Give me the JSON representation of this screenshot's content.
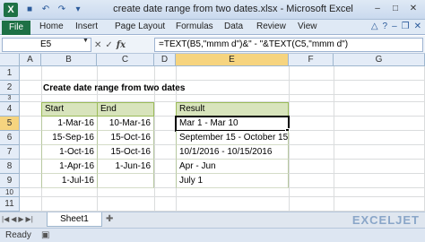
{
  "window": {
    "app_icon": "X",
    "title": "create date range from two dates.xlsx  -  Microsoft Excel",
    "controls": [
      "–",
      "□",
      "✕"
    ]
  },
  "ribbon": {
    "file": "File",
    "tabs": [
      "Home",
      "Insert",
      "Page Layout",
      "Formulas",
      "Data",
      "Review",
      "View"
    ]
  },
  "formula_bar": {
    "name_box": "E5",
    "fx": "fx",
    "formula": "=TEXT(B5,\"mmm d\")&\" - \"&TEXT(C5,\"mmm d\")"
  },
  "columns": [
    "A",
    "B",
    "C",
    "D",
    "E",
    "F",
    "G"
  ],
  "active_column": "E",
  "rows": [
    "1",
    "2",
    "3",
    "4",
    "5",
    "6",
    "7",
    "8",
    "9",
    "10",
    "11"
  ],
  "active_row": "5",
  "sheet": {
    "title": "Create date range from two dates",
    "start_header": "Start",
    "end_header": "End",
    "result_header": "Result",
    "start": [
      "1-Mar-16",
      "15-Sep-16",
      "1-Oct-16",
      "1-Apr-16",
      "1-Jul-16"
    ],
    "end": [
      "10-Mar-16",
      "15-Oct-16",
      "15-Oct-16",
      "1-Jun-16",
      ""
    ],
    "result": [
      "Mar 1 - Mar 10",
      "September 15 - October 15",
      "10/1/2016 - 10/15/2016",
      "Apr - Jun",
      "July 1"
    ]
  },
  "sheet_tabs": [
    "Sheet1"
  ],
  "watermark": "EXCELJET",
  "status": "Ready"
}
